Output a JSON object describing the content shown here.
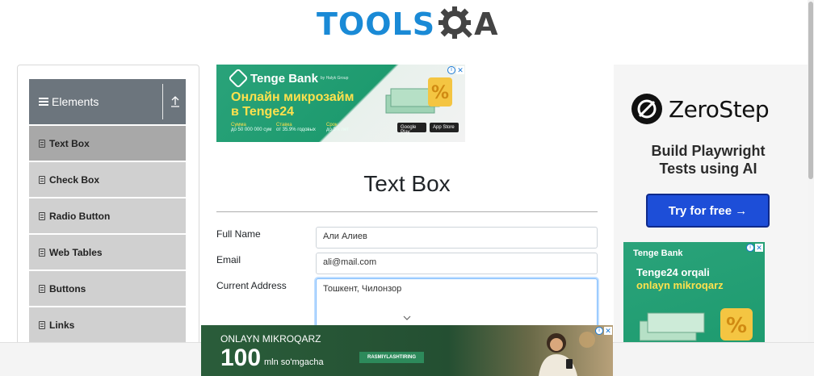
{
  "header": {
    "logo_tools": "TOOLS",
    "logo_a": "A"
  },
  "sidebar": {
    "group_title": "Elements",
    "items": [
      {
        "label": "Text Box",
        "active": true
      },
      {
        "label": "Check Box"
      },
      {
        "label": "Radio Button"
      },
      {
        "label": "Web Tables"
      },
      {
        "label": "Buttons"
      },
      {
        "label": "Links"
      }
    ]
  },
  "ad_top": {
    "brand": "Tenge Bank",
    "brand_sub": "by Halyk Group",
    "line1": "Онлайн микрозайм",
    "line2": "в Tenge24",
    "facts": [
      {
        "k": "Сумма",
        "v": "до 50 000 000 сум"
      },
      {
        "k": "Ставка",
        "v": "от 35.9% годовых"
      },
      {
        "k": "Срок",
        "v": "до 3-х лет"
      }
    ],
    "store1": "Google Play",
    "store2": "App Store",
    "close": "✕",
    "info": "i"
  },
  "form": {
    "title": "Text Box",
    "full_name_label": "Full Name",
    "full_name_value": "Али Алиев",
    "email_label": "Email",
    "email_value": "ali@mail.com",
    "address_label": "Current Address",
    "address_value": "Тошкент, Чилонзор"
  },
  "ad_right": {
    "logo_text": "ZeroStep",
    "tagline": "Build Playwright Tests using AI",
    "button": "Try for free →",
    "bank_brand": "Tenge Bank",
    "bank_line1": "Tenge24 orqali",
    "bank_line2": "onlayn mikroqarz"
  },
  "ad_bottom": {
    "headline": "ONLAYN MIKROQARZ",
    "amount": "100",
    "unit": "mln so'mgacha",
    "cta": "RASMIYLASHTIRING"
  },
  "colors": {
    "accent_blue": "#1a8ad6",
    "sidebar_header": "#6c757d",
    "active_item": "#a8a8a8",
    "zerostep_button": "#1d4ed8"
  }
}
